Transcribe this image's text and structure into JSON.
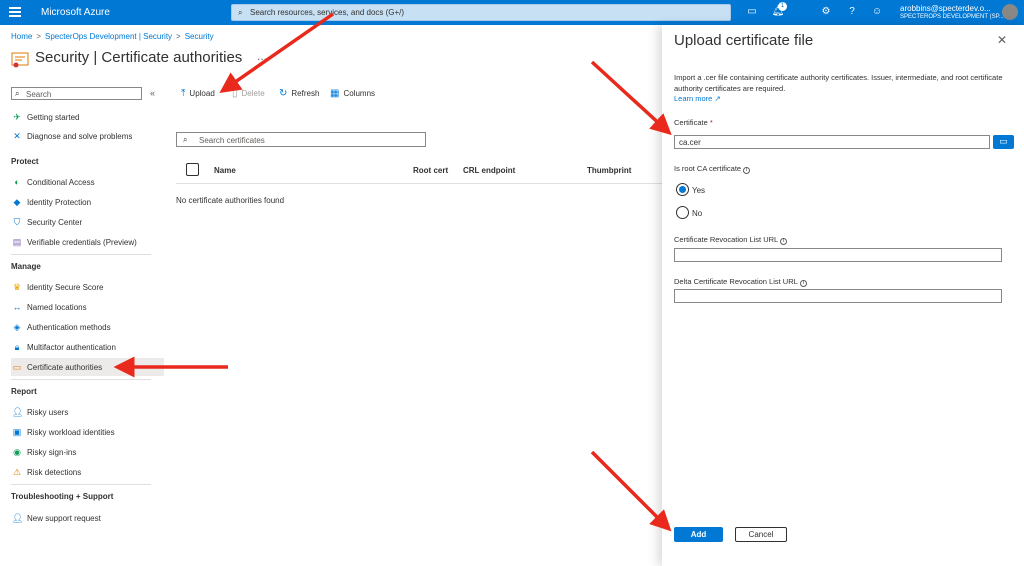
{
  "topbar": {
    "brand": "Microsoft Azure",
    "search_placeholder": "Search resources, services, and docs (G+/)",
    "notification_count": "1",
    "user_name": "arobbins@specterdev.o...",
    "user_tenant": "SPECTEROPS DEVELOPMENT (SP..."
  },
  "breadcrumb": [
    "Home",
    "SpecterOps Development | Security",
    "Security"
  ],
  "page": {
    "title": "Security | Certificate authorities",
    "more": "..."
  },
  "sidebar": {
    "search_placeholder": "Search",
    "collapse": "«",
    "top_items": [
      {
        "label": "Getting started",
        "icon": "rocket-icon"
      },
      {
        "label": "Diagnose and solve problems",
        "icon": "wrench-icon"
      }
    ],
    "sections": [
      {
        "heading": "Protect",
        "items": [
          {
            "label": "Conditional Access",
            "icon": "conditional-access-icon"
          },
          {
            "label": "Identity Protection",
            "icon": "identity-protection-icon"
          },
          {
            "label": "Security Center",
            "icon": "shield-icon"
          },
          {
            "label": "Verifiable credentials (Preview)",
            "icon": "credential-icon"
          }
        ]
      },
      {
        "heading": "Manage",
        "items": [
          {
            "label": "Identity Secure Score",
            "icon": "trophy-icon"
          },
          {
            "label": "Named locations",
            "icon": "locations-icon"
          },
          {
            "label": "Authentication methods",
            "icon": "auth-methods-icon"
          },
          {
            "label": "Multifactor authentication",
            "icon": "lock-icon"
          },
          {
            "label": "Certificate authorities",
            "icon": "certificate-icon",
            "active": true
          }
        ]
      },
      {
        "heading": "Report",
        "items": [
          {
            "label": "Risky users",
            "icon": "risky-users-icon"
          },
          {
            "label": "Risky workload identities",
            "icon": "risky-workload-icon"
          },
          {
            "label": "Risky sign-ins",
            "icon": "risky-signins-icon"
          },
          {
            "label": "Risk detections",
            "icon": "warning-icon"
          }
        ]
      },
      {
        "heading": "Troubleshooting + Support",
        "items": [
          {
            "label": "New support request",
            "icon": "support-icon"
          }
        ]
      }
    ]
  },
  "toolbar": {
    "upload": "Upload",
    "delete": "Delete",
    "refresh": "Refresh",
    "columns": "Columns"
  },
  "certs": {
    "search_placeholder": "Search certificates",
    "columns": [
      "Name",
      "Root cert",
      "CRL endpoint",
      "Thumbprint"
    ],
    "empty": "No certificate authorities found"
  },
  "panel": {
    "title": "Upload certificate file",
    "close": "✕",
    "description": "Import a .cer file containing certificate authority certificates. Issuer, intermediate, and root certificate authority certificates are required.",
    "learn_more": "Learn more",
    "certificate_label": "Certificate",
    "required_mark": "*",
    "certificate_value": "ca.cer",
    "is_root_label": "Is root CA certificate",
    "yes": "Yes",
    "no": "No",
    "is_root_selected": "Yes",
    "crl_label": "Certificate Revocation List URL",
    "crl_value": "",
    "delta_crl_label": "Delta Certificate Revocation List URL",
    "delta_crl_value": "",
    "add": "Add",
    "cancel": "Cancel"
  },
  "colors": {
    "azure_blue": "#0078d4",
    "annotation_arrow": "#e8291c"
  }
}
